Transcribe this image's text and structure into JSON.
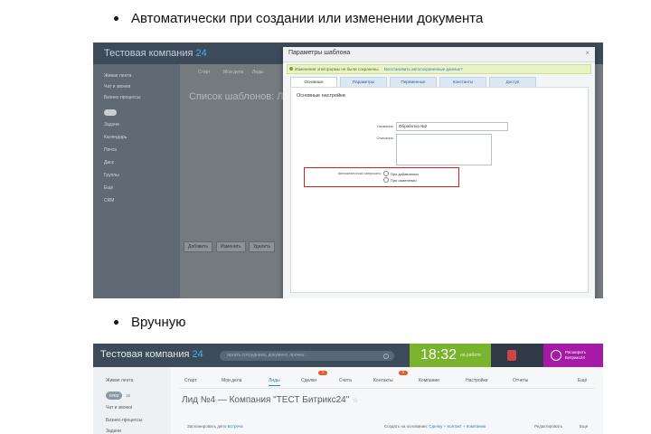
{
  "bullets": {
    "first": "Автоматически при создании или изменении документа",
    "second": "Вручную"
  },
  "shot1": {
    "company_name": "Тестовая компания",
    "company_suffix": "24",
    "sidebar_items": [
      "Живая лента",
      "Чат и звонки",
      "Бизнес-процессы",
      "Задачи",
      "Календарь",
      "Почта",
      "Диск",
      "Группы",
      "Ещё",
      "CRM"
    ],
    "tabs_dim": [
      "Старт",
      "Мои дела",
      "Лиды"
    ],
    "heading": "Список шаблонов: Лид",
    "bottom_buttons": [
      "Добавить",
      "Изменить",
      "Удалить"
    ],
    "dialog": {
      "title": "Параметры шаблона",
      "close": "×",
      "warning": "Изменения этой формы не были сохранены.",
      "warning_link": "Восстановить автосохраненные данные?",
      "tabs": [
        "Основные",
        "Параметры",
        "Переменные",
        "Константы",
        "Доступ"
      ],
      "section_title": "Основные настройки",
      "name_label": "Название:",
      "name_value": "Обработка №2",
      "desc_label": "Описание:",
      "autorun_label": "Автоматически запускать:",
      "options": [
        "При добавлении",
        "При изменении"
      ]
    }
  },
  "shot2": {
    "company_name": "Тестовая компания",
    "company_suffix": "24",
    "search_placeholder": "искать сотрудника, документ, прочее...",
    "time": "18:32",
    "time_status": "на работе",
    "promo": "Расширить Битрикс24",
    "sidebar_items": [
      "Живая лента",
      "Чат и звонки",
      "Бизнес-процессы",
      "Задачи"
    ],
    "sidebar_pill": "CRM",
    "sidebar_count": "15",
    "nav_tabs": [
      "Старт",
      "Мои дела",
      "Лиды",
      "Сделки",
      "Счета",
      "Контакты",
      "Компании",
      "Настройки",
      "Отчеты",
      "Ещё"
    ],
    "nav_badges": [
      "1",
      "5"
    ],
    "page_title": "Лид №4 — Компания \"ТЕСТ Битрикс24\"",
    "sub_left": "Запланировать дело",
    "sub_left_link": "Встреча",
    "sub_right": "Создать на основании:",
    "sub_right_link": "Сделку + Контакт + Компанию",
    "edit": "Редактировать",
    "more": "Ещё"
  }
}
